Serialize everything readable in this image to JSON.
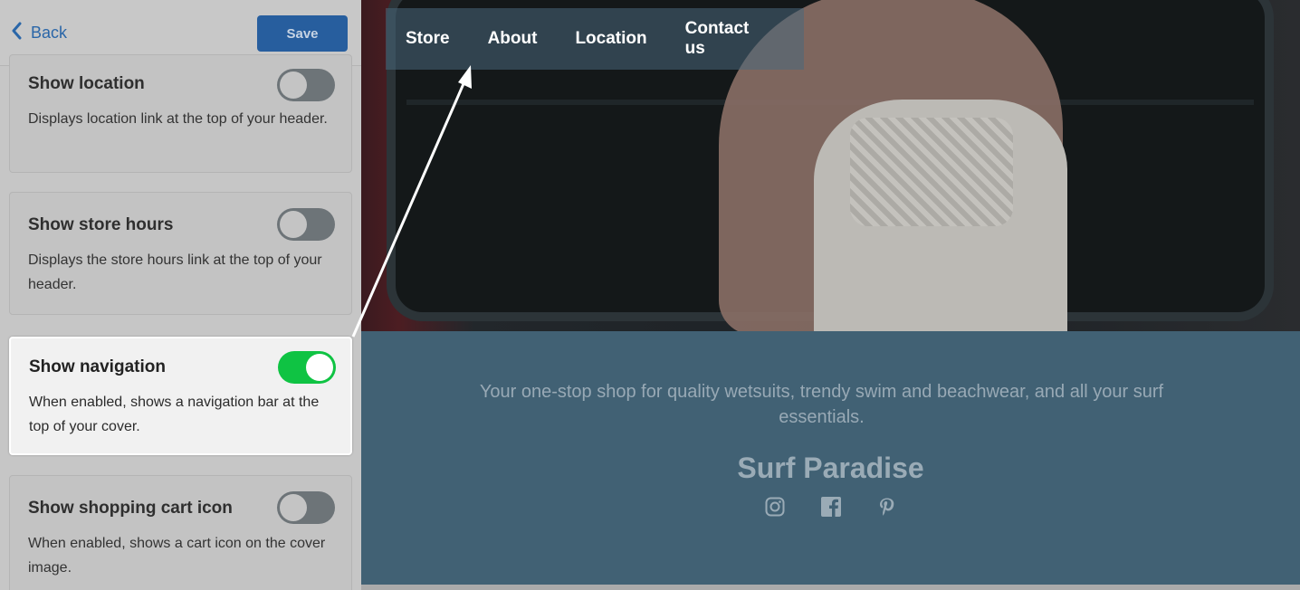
{
  "header": {
    "back_label": "Back",
    "save_label": "Save"
  },
  "settings": [
    {
      "title": "Show location",
      "description": "Displays location link at the top of your header.",
      "enabled": false
    },
    {
      "title": "Show store hours",
      "description": "Displays the store hours link at the top of your header.",
      "enabled": false
    },
    {
      "title": "Show navigation",
      "description": "When enabled, shows a navigation bar at the top of your cover.",
      "enabled": true
    },
    {
      "title": "Show shopping cart icon",
      "description": "When enabled, shows a cart icon on the cover image.",
      "enabled": false
    }
  ],
  "preview": {
    "nav": [
      "Store",
      "About",
      "Location",
      "Contact us"
    ],
    "tagline": "Your one-stop shop for quality wetsuits, trendy swim and beachwear, and all your surf essentials.",
    "store_name": "Surf Paradise",
    "socials": [
      "instagram-icon",
      "facebook-icon",
      "pinterest-icon"
    ]
  },
  "colors": {
    "accent": "#275e9e",
    "toggle_on": "#0fc343",
    "toggle_off": "#6d7478",
    "info_bg": "#416174"
  }
}
